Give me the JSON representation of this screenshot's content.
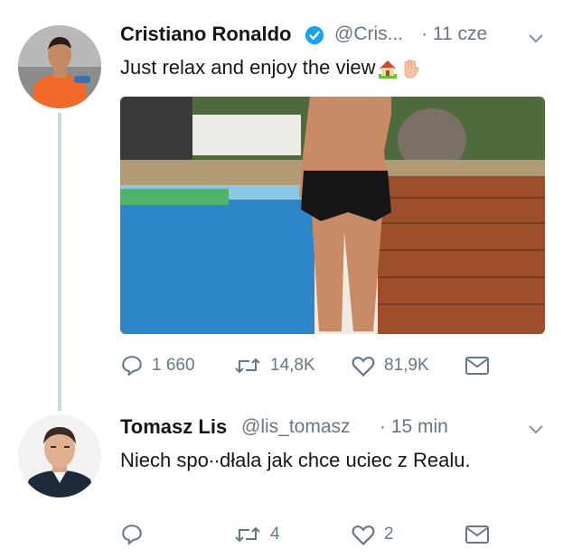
{
  "tweet1": {
    "name": "Cristiano Ronaldo",
    "handle": "@Cris...",
    "time": "· 11 cze",
    "text": "Just relax and enjoy the view",
    "emoji_icons": [
      "house-icon",
      "raised-hand-icon"
    ],
    "actions": {
      "reply_count": "1 660",
      "retweet_count": "14,8K",
      "like_count": "81,9K"
    }
  },
  "tweet2": {
    "name": "Tomasz Lis",
    "handle": "@lis_tomasz",
    "time": "· 15 min",
    "text": "Niech spo∙∙dłala jak chce uciec z Realu.",
    "actions": {
      "reply_count": "",
      "retweet_count": "4",
      "like_count": "2"
    }
  },
  "colors": {
    "verified": "#1da1f2",
    "muted": "#657786",
    "thread_line": "#ccd6dd"
  }
}
